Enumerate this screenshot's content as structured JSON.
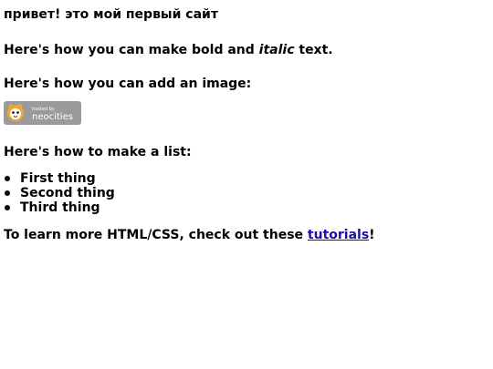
{
  "title": "привет! это мой первый сайт",
  "bold_paragraph": {
    "before": "Here's how you can make bold and ",
    "italic": "italic",
    "after": " text."
  },
  "image_paragraph": "Here's how you can add an image:",
  "badge": {
    "small": "hosted by",
    "brand": "neocities"
  },
  "list_paragraph": "Here's how to make a list:",
  "list_items": [
    "First thing",
    "Second thing",
    "Third thing"
  ],
  "learn_paragraph": {
    "before": "To learn more HTML/CSS, check out these ",
    "link": "tutorials",
    "after": "!"
  }
}
